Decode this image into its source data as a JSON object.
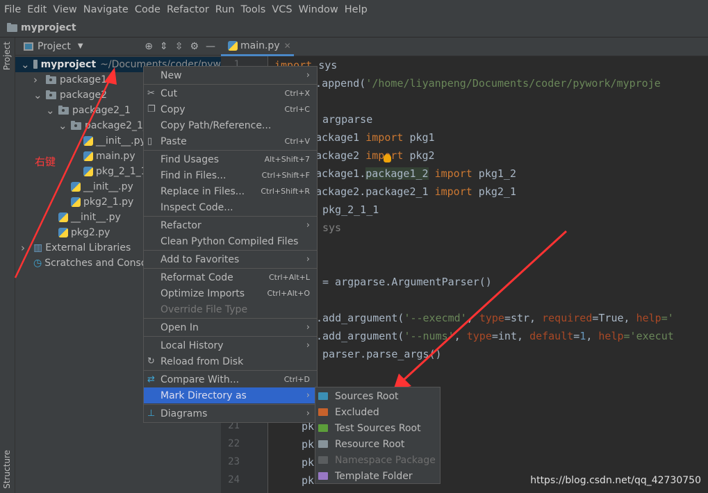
{
  "menubar": [
    "File",
    "Edit",
    "View",
    "Navigate",
    "Code",
    "Refactor",
    "Run",
    "Tools",
    "VCS",
    "Window",
    "Help"
  ],
  "breadcrumb": "myproject",
  "stripe": {
    "project": "Project",
    "structure": "Structure"
  },
  "panel": {
    "title": "Project"
  },
  "tree": [
    {
      "label": "myproject",
      "path": "~/Documents/coder/pyw",
      "level": 0,
      "type": "folder",
      "open": true
    },
    {
      "label": "package1",
      "level": 1,
      "type": "package",
      "open": false
    },
    {
      "label": "package2",
      "level": 1,
      "type": "package",
      "open": true
    },
    {
      "label": "package2_1",
      "level": 2,
      "type": "package",
      "open": true
    },
    {
      "label": "package2_1_",
      "level": 3,
      "type": "package",
      "open": true
    },
    {
      "label": "__init__.py",
      "level": 4,
      "type": "py"
    },
    {
      "label": "main.py",
      "level": 4,
      "type": "py"
    },
    {
      "label": "pkg_2_1_1",
      "level": 4,
      "type": "py"
    },
    {
      "label": "__init__.py",
      "level": 3,
      "type": "py"
    },
    {
      "label": "pkg2_1.py",
      "level": 3,
      "type": "py"
    },
    {
      "label": "__init__.py",
      "level": 2,
      "type": "py"
    },
    {
      "label": "pkg2.py",
      "level": 2,
      "type": "py"
    },
    {
      "label": "External Libraries",
      "level": 0,
      "type": "lib",
      "open": false
    },
    {
      "label": "Scratches and Consol",
      "level": 0,
      "type": "scratch"
    }
  ],
  "tab": {
    "label": "main.py"
  },
  "line_numbers": [
    "1",
    "21",
    "22",
    "23",
    "24"
  ],
  "code": [
    {
      "line": 1,
      "segs": [
        [
          "import",
          "kw"
        ],
        [
          " sys",
          ""
        ]
      ]
    },
    {
      "line": 2,
      "segs": [
        [
          "th.append(",
          ""
        ],
        [
          "'/home/liyanpeng/Documents/coder/pywork/myproje",
          "str"
        ]
      ]
    },
    {
      "line": 4,
      "segs": [
        [
          "argparse",
          ""
        ]
      ]
    },
    {
      "line": 5,
      "segs": [
        [
          "ackage1 ",
          ""
        ],
        [
          "import",
          "kw"
        ],
        [
          " pkg1",
          ""
        ]
      ]
    },
    {
      "line": 6,
      "segs": [
        [
          "ackage2 ",
          ""
        ],
        [
          "import",
          "kw"
        ],
        [
          " pkg2",
          ""
        ]
      ]
    },
    {
      "line": 7,
      "segs": [
        [
          "ackage1.",
          ""
        ],
        [
          "package1_2",
          "hl"
        ],
        [
          " ",
          ""
        ],
        [
          "import",
          "kw"
        ],
        [
          " pkg1_2",
          ""
        ]
      ]
    },
    {
      "line": 8,
      "segs": [
        [
          "ackage2.package2_1 ",
          ""
        ],
        [
          "import",
          "kw"
        ],
        [
          " pkg2_1",
          ""
        ]
      ]
    },
    {
      "line": 9,
      "segs": [
        [
          "pkg_2_1_1",
          ""
        ]
      ]
    },
    {
      "line": 10,
      "segs": [
        [
          "sys",
          "gray"
        ]
      ]
    },
    {
      "line": 13,
      "segs": [
        [
          "= argparse.ArgumentParser()",
          ""
        ]
      ]
    },
    {
      "line": 15,
      "segs": [
        [
          ".add_argument(",
          ""
        ],
        [
          "'--execmd'",
          "str"
        ],
        [
          ", ",
          ""
        ],
        [
          "type",
          "param"
        ],
        [
          "=str, ",
          ""
        ],
        [
          "required",
          "param"
        ],
        [
          "=True, ",
          ""
        ],
        [
          "help",
          "param"
        ],
        [
          "='",
          "str"
        ]
      ]
    },
    {
      "line": 16,
      "segs": [
        [
          ".add_argument(",
          ""
        ],
        [
          "'--nums'",
          "str"
        ],
        [
          ", ",
          ""
        ],
        [
          "type",
          "param"
        ],
        [
          "=int, ",
          ""
        ],
        [
          "default",
          "param"
        ],
        [
          "=",
          ""
        ],
        [
          "1",
          "num"
        ],
        [
          ", ",
          ""
        ],
        [
          "help",
          "param"
        ],
        [
          "='execut",
          "str"
        ]
      ]
    },
    {
      "line": 17,
      "segs": [
        [
          "parser.parse_args()",
          ""
        ]
      ]
    },
    {
      "line": 21,
      "segs": [
        [
          "pk",
          ""
        ]
      ]
    },
    {
      "line": 22,
      "segs": [
        [
          "pk",
          ""
        ]
      ]
    },
    {
      "line": 23,
      "segs": [
        [
          "pk",
          ""
        ]
      ]
    },
    {
      "line": 24,
      "segs": [
        [
          "pk",
          ""
        ]
      ]
    }
  ],
  "context_menu": [
    {
      "label": "New",
      "submenu": true
    },
    "sep",
    {
      "label": "Cut",
      "shortcut": "Ctrl+X",
      "icon": "scissors-icon"
    },
    {
      "label": "Copy",
      "shortcut": "Ctrl+C",
      "icon": "copy-icon"
    },
    {
      "label": "Copy Path/Reference..."
    },
    {
      "label": "Paste",
      "shortcut": "Ctrl+V",
      "icon": "clipboard-icon"
    },
    "sep",
    {
      "label": "Find Usages",
      "shortcut": "Alt+Shift+7"
    },
    {
      "label": "Find in Files...",
      "shortcut": "Ctrl+Shift+F"
    },
    {
      "label": "Replace in Files...",
      "shortcut": "Ctrl+Shift+R"
    },
    {
      "label": "Inspect Code..."
    },
    "sep",
    {
      "label": "Refactor",
      "submenu": true
    },
    {
      "label": "Clean Python Compiled Files"
    },
    "sep",
    {
      "label": "Add to Favorites",
      "submenu": true
    },
    "sep",
    {
      "label": "Reformat Code",
      "shortcut": "Ctrl+Alt+L"
    },
    {
      "label": "Optimize Imports",
      "shortcut": "Ctrl+Alt+O"
    },
    {
      "label": "Override File Type",
      "disabled": true
    },
    "sep",
    {
      "label": "Open In",
      "submenu": true
    },
    "sep",
    {
      "label": "Local History",
      "submenu": true
    },
    {
      "label": "Reload from Disk",
      "icon": "reload-icon"
    },
    "sep",
    {
      "label": "Compare With...",
      "shortcut": "Ctrl+D",
      "icon": "compare-icon"
    },
    {
      "label": "Mark Directory as",
      "submenu": true,
      "highlighted": true
    },
    "sep",
    {
      "label": "Diagrams",
      "submenu": true,
      "icon": "diagram-icon"
    }
  ],
  "submenu": [
    {
      "label": "Sources Root",
      "color": "#3b8fb5"
    },
    {
      "label": "Excluded",
      "color": "#c7622c"
    },
    {
      "label": "Test Sources Root",
      "color": "#5c9e3a"
    },
    {
      "label": "Resource Root",
      "color": "#87939a"
    },
    {
      "label": "Namespace Package",
      "color": "#5a5d5f",
      "disabled": true
    },
    {
      "label": "Template Folder",
      "color": "#9878c4"
    }
  ],
  "annotation": "右键",
  "watermark": "https://blog.csdn.net/qq_42730750",
  "colors": {
    "highlight": "#2f65ca",
    "arrow": "#ff3333"
  }
}
